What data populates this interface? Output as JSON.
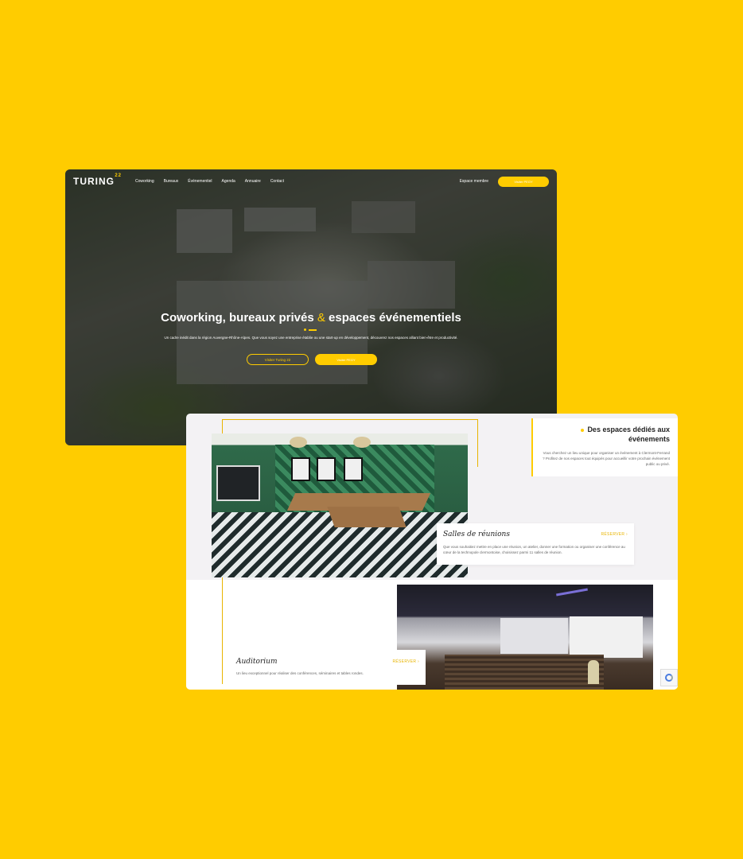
{
  "colors": {
    "background": "#ffcc00",
    "accent": "#ffcc00",
    "dark": "#222222"
  },
  "hero": {
    "logo": "TURING",
    "logo_sup": "22",
    "menu": [
      "Coworking",
      "Bureaux",
      "Évènementiel",
      "Agenda",
      "Annuaire",
      "Contact"
    ],
    "member_link": "Espace membre",
    "cta_nav": "Visiter PEGY",
    "title_a": "Coworking, bureaux privés ",
    "title_amp": "&",
    "title_b": " espaces événementiels",
    "subtitle": "Un cadre inédit dans la région Auvergne-Rhône-Alpes. Que vous soyez une entreprise établie ou une start-up en développement, découvrez nos espaces alliant bien-être et productivité.",
    "btn_visit": "Visiter Turing 22",
    "btn_cta": "Visiter PEGY"
  },
  "events": {
    "section_title": "Des espaces dédiés aux événements",
    "section_text": "Vous cherchez un lieu unique pour organiser un événement à Clermont-Ferrand ? Profitez de nos espaces tout équipés pour accueillir votre prochain événement public ou privé.",
    "salles_title": "Salles de réunions",
    "salles_text": "Que vous souhaitiez mettre en place une réunion, un atelier, donner une formation ou organiser une conférence au cœur de la technopole clermontoise, choisissez parmi 11 salles de réunion.",
    "reserve_label": "RÉSERVER",
    "audi_title": "Auditorium",
    "audi_text": "Un lieu exceptionnel pour réaliser des conférences, séminaires et tables rondes."
  }
}
